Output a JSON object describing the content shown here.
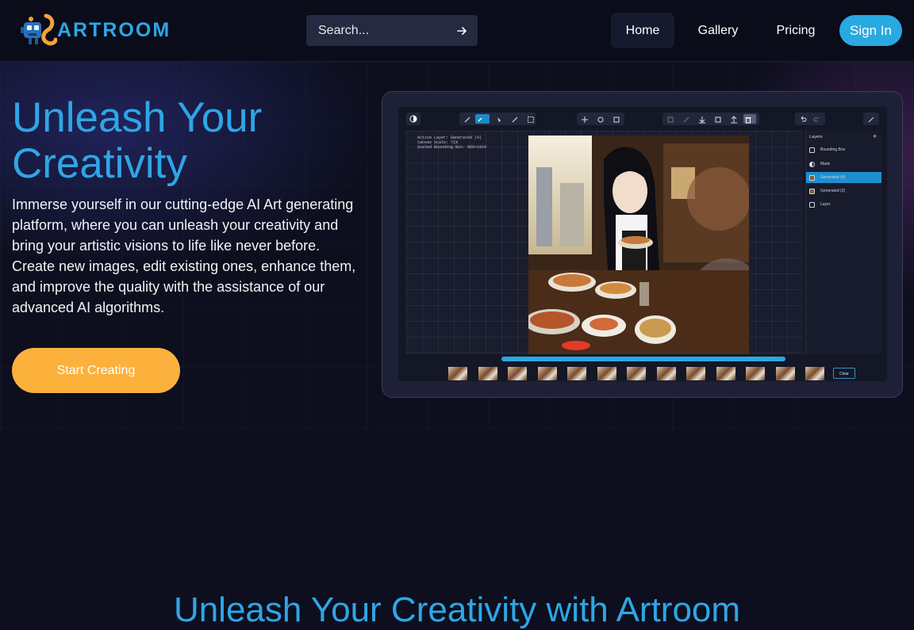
{
  "header": {
    "logo_text": "ARTROOM",
    "search": {
      "placeholder": "Search..."
    },
    "nav": {
      "home": "Home",
      "gallery": "Gallery",
      "pricing": "Pricing"
    },
    "sign_in": "Sign In"
  },
  "hero": {
    "title": "Unleash Your Creativity",
    "description": "Immerse yourself in our cutting-edge AI Art generating platform, where you can unleash your creativity and bring your artistic visions to life like never before. Create new images, edit existing ones, enhance them, and improve the quality with the assistance of our advanced AI algorithms.",
    "cta": "Start Creating"
  },
  "app_preview": {
    "info": [
      "Active Layer: Generated (4)",
      "Canvas Scale: 71%",
      "Scaled Bounding Box: 960×1024"
    ],
    "layers_title": "Layers",
    "layers": [
      "Bounding Box",
      "Mask",
      "Generated (4)",
      "Generated (3)",
      "Layer"
    ],
    "active_layer_index": 2,
    "progress": 1.0,
    "clear_label": "Clear"
  },
  "section2": {
    "title": "Unleash Your Creativity with Artroom"
  },
  "colors": {
    "accent": "#2ea6e6",
    "cta": "#fbb13c",
    "signin": "#29a9e1",
    "background": "#0d0f1e"
  }
}
